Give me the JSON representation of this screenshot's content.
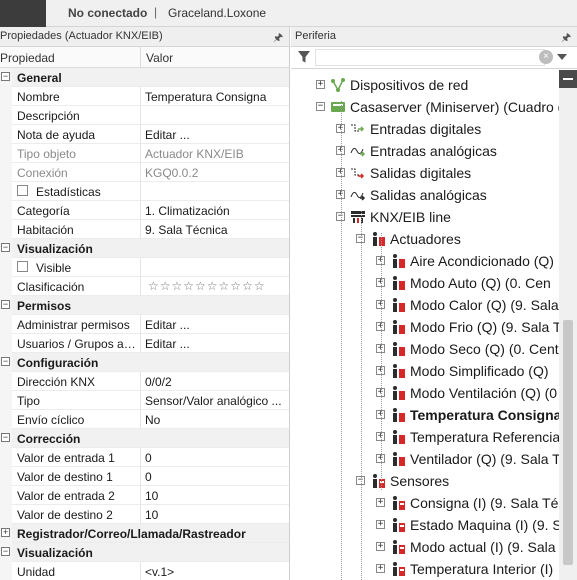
{
  "topbar": {
    "status": "No conectado",
    "separator": "|",
    "project": "Graceland.Loxone"
  },
  "properties": {
    "title": "Propiedades (Actuador KNX/EIB)",
    "col_prop": "Propiedad",
    "col_val": "Valor",
    "rows": [
      {
        "type": "cat",
        "label": "General",
        "box": "−"
      },
      {
        "label": "Nombre",
        "value": "Temperatura Consigna"
      },
      {
        "label": "Descripción",
        "value": ""
      },
      {
        "label": "Nota de ayuda",
        "value": "Editar ..."
      },
      {
        "label": "Tipo objeto",
        "value": "Actuador KNX/EIB",
        "disabled": true
      },
      {
        "label": "Conexión",
        "value": "KGQ0.0.2",
        "disabled": true
      },
      {
        "type": "check",
        "label": "Estadísticas",
        "value": ""
      },
      {
        "label": "Categoría",
        "value": "1. Climatización"
      },
      {
        "label": "Habitación",
        "value": "9. Sala Técnica"
      },
      {
        "type": "cat",
        "label": "Visualización",
        "box": "−"
      },
      {
        "type": "check",
        "label": "Visible",
        "value": ""
      },
      {
        "type": "stars",
        "label": "Clasificación",
        "value": "☆☆☆☆☆☆☆☆☆☆"
      },
      {
        "type": "cat",
        "label": "Permisos",
        "box": "−"
      },
      {
        "label": "Administrar permisos",
        "value": "Editar ..."
      },
      {
        "label": "Usuarios / Grupos au...",
        "value": "Editar ..."
      },
      {
        "type": "cat",
        "label": "Configuración",
        "box": "−"
      },
      {
        "label": "Dirección KNX",
        "value": "0/0/2"
      },
      {
        "label": "Tipo",
        "value": "Sensor/Valor analógico ..."
      },
      {
        "label": "Envío cíclico",
        "value": "No"
      },
      {
        "type": "cat",
        "label": "Corrección",
        "box": "−"
      },
      {
        "label": "Valor de entrada 1",
        "value": "0"
      },
      {
        "label": "Valor de destino 1",
        "value": "0"
      },
      {
        "label": "Valor de entrada 2",
        "value": "10"
      },
      {
        "label": "Valor de destino 2",
        "value": "10"
      },
      {
        "type": "cat",
        "label": "Registrador/Correo/Llamada/Rastreador",
        "box": "+"
      },
      {
        "type": "cat",
        "label": "Visualización",
        "box": "−"
      },
      {
        "label": "Unidad",
        "value": "<v.1>"
      }
    ]
  },
  "periferia": {
    "title": "Periferia",
    "filter_placeholder": "",
    "tree": [
      {
        "text": "Dispositivos de red",
        "exp": "+",
        "icon": "network-icon",
        "indent": 0
      },
      {
        "text": "Casaserver (Miniserver) (Cuadro de",
        "exp": "−",
        "icon": "miniserver-icon",
        "indent": 0
      },
      {
        "text": "Entradas digitales",
        "exp": "+",
        "icon": "digital-input-icon",
        "indent": 1
      },
      {
        "text": "Entradas analógicas",
        "exp": "+",
        "icon": "analog-input-icon",
        "indent": 1
      },
      {
        "text": "Salidas digitales",
        "exp": "+",
        "icon": "digital-output-icon",
        "indent": 1
      },
      {
        "text": "Salidas analógicas",
        "exp": "+",
        "icon": "analog-output-icon",
        "indent": 1
      },
      {
        "text": "KNX/EIB line",
        "exp": "−",
        "icon": "knx-line-icon",
        "indent": 1
      },
      {
        "text": "Actuadores",
        "exp": "−",
        "icon": "actuator-group-icon",
        "indent": 2
      },
      {
        "text": "Aire Acondicionado (Q)",
        "exp": "+",
        "icon": "actuator-icon",
        "indent": 3
      },
      {
        "text": "Modo Auto (Q) (0. Cen",
        "exp": "+",
        "icon": "actuator-icon",
        "indent": 3
      },
      {
        "text": "Modo Calor (Q) (9. Sala",
        "exp": "+",
        "icon": "actuator-icon",
        "indent": 3
      },
      {
        "text": "Modo Frio (Q) (9. Sala T",
        "exp": "+",
        "icon": "actuator-icon",
        "indent": 3
      },
      {
        "text": "Modo Seco (Q) (0. Cent",
        "exp": "+",
        "icon": "actuator-icon",
        "indent": 3
      },
      {
        "text": "Modo Simplificado (Q)",
        "exp": "+",
        "icon": "actuator-icon",
        "indent": 3
      },
      {
        "text": "Modo Ventilación (Q) (0",
        "exp": "+",
        "icon": "actuator-icon",
        "indent": 3
      },
      {
        "text": "Temperatura Consigna",
        "exp": "+",
        "icon": "actuator-icon",
        "indent": 3,
        "bold": true
      },
      {
        "text": "Temperatura Referencia",
        "exp": "+",
        "icon": "actuator-icon",
        "indent": 3
      },
      {
        "text": "Ventilador (Q) (9. Sala T",
        "exp": "+",
        "icon": "actuator-icon",
        "indent": 3
      },
      {
        "text": "Sensores",
        "exp": "−",
        "icon": "sensor-group-icon",
        "indent": 2
      },
      {
        "text": "Consigna (I) (9. Sala Téc",
        "exp": "+",
        "icon": "sensor-icon",
        "indent": 3
      },
      {
        "text": "Estado Maquina (I) (9. S",
        "exp": "+",
        "icon": "sensor-icon",
        "indent": 3
      },
      {
        "text": "Modo actual (I) (9. Sala",
        "exp": "+",
        "icon": "sensor-icon",
        "indent": 3
      },
      {
        "text": "Temperatura Interior (I)",
        "exp": "+",
        "icon": "sensor-icon",
        "indent": 3
      }
    ]
  }
}
